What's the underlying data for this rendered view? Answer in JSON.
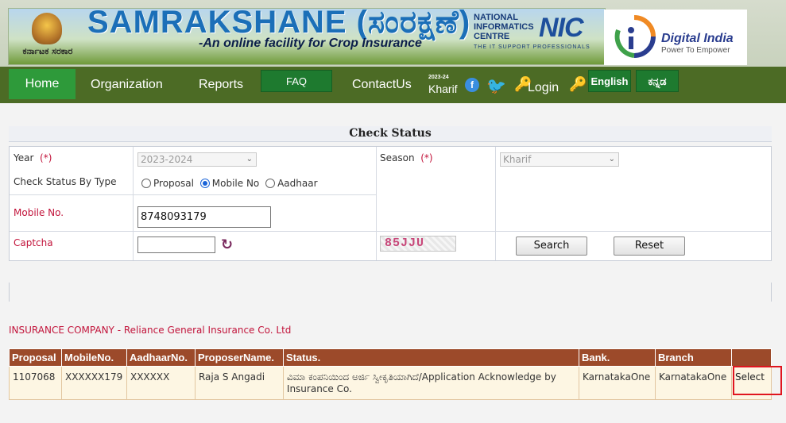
{
  "header": {
    "emblem_text": "ಕರ್ನಾಟಕ ಸರಕಾರ",
    "title": "SAMRAKSHANE (ಸಂರಕ್ಷಣೆ)",
    "subtitle": "-An online facility for Crop Insurance",
    "nic_line1": "NATIONAL",
    "nic_line2": "INFORMATICS",
    "nic_line3": "CENTRE",
    "nic_logo": "NIC",
    "nic_tagline": "THE IT SUPPORT PROFESSIONALS",
    "di_name": "Digital India",
    "di_tagline": "Power To Empower"
  },
  "nav": {
    "home": "Home",
    "organization": "Organization",
    "reports": "Reports",
    "faq": "FAQ",
    "contact": "ContactUs",
    "season_year": "2023-24",
    "season_name": "Kharif",
    "login": "Login",
    "english": "English",
    "kannada": "ಕನ್ನಡ",
    "facebook_glyph": "f",
    "twitter_glyph": "🐦",
    "login_glyph": "🔑"
  },
  "check_status": {
    "title": "Check Status",
    "year_label": "Year",
    "required_mark": "(*)",
    "year_value": "2023-2024",
    "season_label": "Season",
    "season_value": "Kharif",
    "by_type_label": "Check Status By Type",
    "options": [
      "Proposal",
      "Mobile No",
      "Aadhaar"
    ],
    "selected_option": "Mobile No",
    "mobile_label": "Mobile No.",
    "mobile_value": "8748093179",
    "captcha_label": "Captcha",
    "captcha_value": "",
    "captcha_text": "85JJU",
    "refresh_glyph": "↻",
    "search_button": "Search",
    "reset_button": "Reset"
  },
  "company_line": "INSURANCE COMPANY - Reliance General Insurance Co. Ltd",
  "results": {
    "columns": [
      "Proposal",
      "MobileNo.",
      "AadhaarNo.",
      "ProposerName.",
      "Status.",
      "Bank.",
      "Branch",
      ""
    ],
    "rows": [
      {
        "proposal": "1107068",
        "mobile": "XXXXXX179",
        "aadhaar": "XXXXXX",
        "name": "Raja S Angadi",
        "status": "ವಿಮಾ ಕಂಪನಿಯಿಂದ ಅರ್ಜಿ ಸ್ವೀಕೃತಿಯಾಗಿದೆ/Application Acknowledge by Insurance Co.",
        "bank": "KarnatakaOne",
        "branch": "KarnatakaOne",
        "action": "Select"
      }
    ]
  },
  "colors": {
    "nav_bg": "#4c6b25",
    "home_active": "#2e9a3a",
    "table_header": "#9c4a2a",
    "table_row": "#fdf6e3",
    "label_red": "#c2143b",
    "highlight_border": "#e0151f"
  }
}
